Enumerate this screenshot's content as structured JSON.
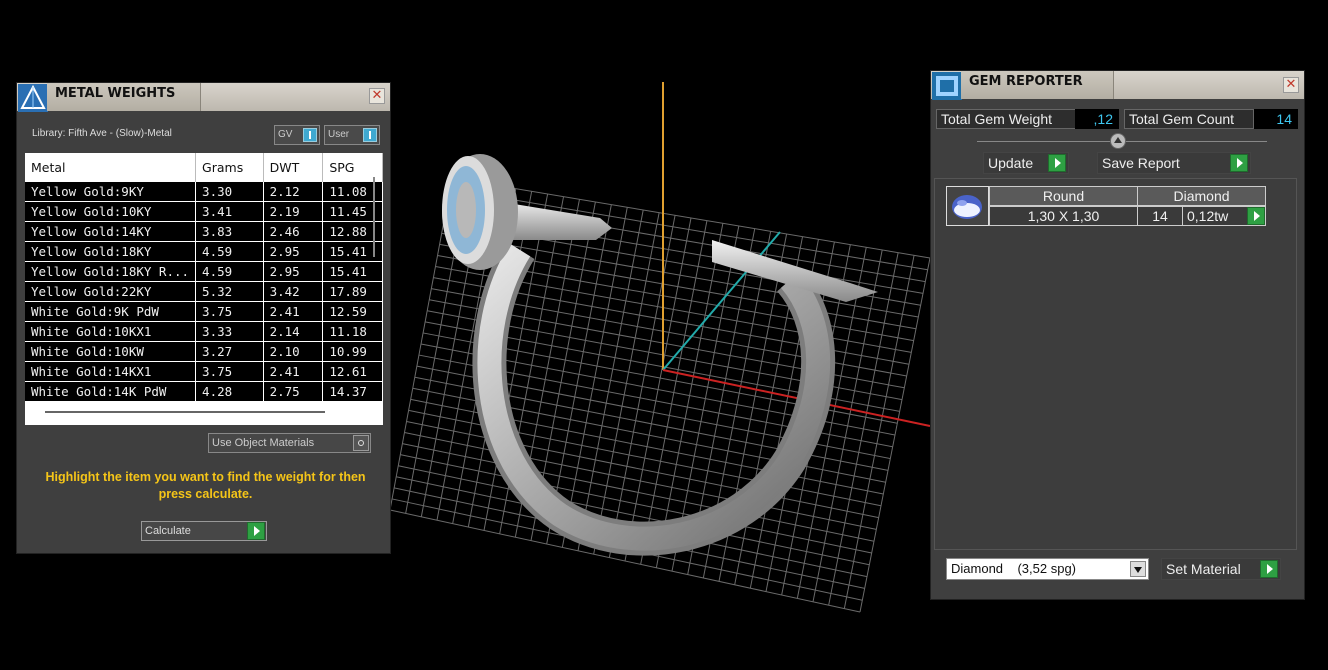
{
  "metal_weights": {
    "title": "METAL WEIGHTS",
    "library_label": "Library: Fifth Ave - (Slow)-Metal",
    "toggle_gv": "GV",
    "toggle_user": "User",
    "columns": [
      "Metal",
      "Grams",
      "DWT",
      "SPG"
    ],
    "rows": [
      [
        "Yellow Gold:9KY",
        "3.30",
        "2.12",
        "11.08"
      ],
      [
        "Yellow Gold:10KY",
        "3.41",
        "2.19",
        "11.45"
      ],
      [
        "Yellow Gold:14KY",
        "3.83",
        "2.46",
        "12.88"
      ],
      [
        "Yellow Gold:18KY",
        "4.59",
        "2.95",
        "15.41"
      ],
      [
        "Yellow Gold:18KY R...",
        "4.59",
        "2.95",
        "15.41"
      ],
      [
        "Yellow Gold:22KY",
        "5.32",
        "3.42",
        "17.89"
      ],
      [
        "White Gold:9K PdW",
        "3.75",
        "2.41",
        "12.59"
      ],
      [
        "White Gold:10KX1",
        "3.33",
        "2.14",
        "11.18"
      ],
      [
        "White Gold:10KW",
        "3.27",
        "2.10",
        "10.99"
      ],
      [
        "White Gold:14KX1",
        "3.75",
        "2.41",
        "12.61"
      ],
      [
        "White Gold:14K PdW",
        "4.28",
        "2.75",
        "14.37"
      ]
    ],
    "use_object_materials": "Use Object Materials",
    "hint": "Highlight the item you want to find the weight for then press calculate.",
    "calculate_label": "Calculate"
  },
  "gem_reporter": {
    "title": "GEM REPORTER",
    "total_weight_label": "Total Gem Weight",
    "total_weight_value": ",12",
    "total_count_label": "Total Gem Count",
    "total_count_value": "14",
    "update_label": "Update",
    "save_report_label": "Save Report",
    "gem": {
      "shape": "Round",
      "material": "Diamond",
      "size": "1,30 X 1,30",
      "count": "14",
      "weight": "0,12tw"
    },
    "material_select": "Diamond    (3,52 spg)",
    "set_material_label": "Set Material"
  },
  "colors": {
    "accent_value": "#3ec7f0",
    "hint_text": "#f5c518",
    "play_button": "#2ea043",
    "axis_x": "#cc2222",
    "axis_y": "#22aaaa",
    "axis_z": "#e0a030"
  }
}
